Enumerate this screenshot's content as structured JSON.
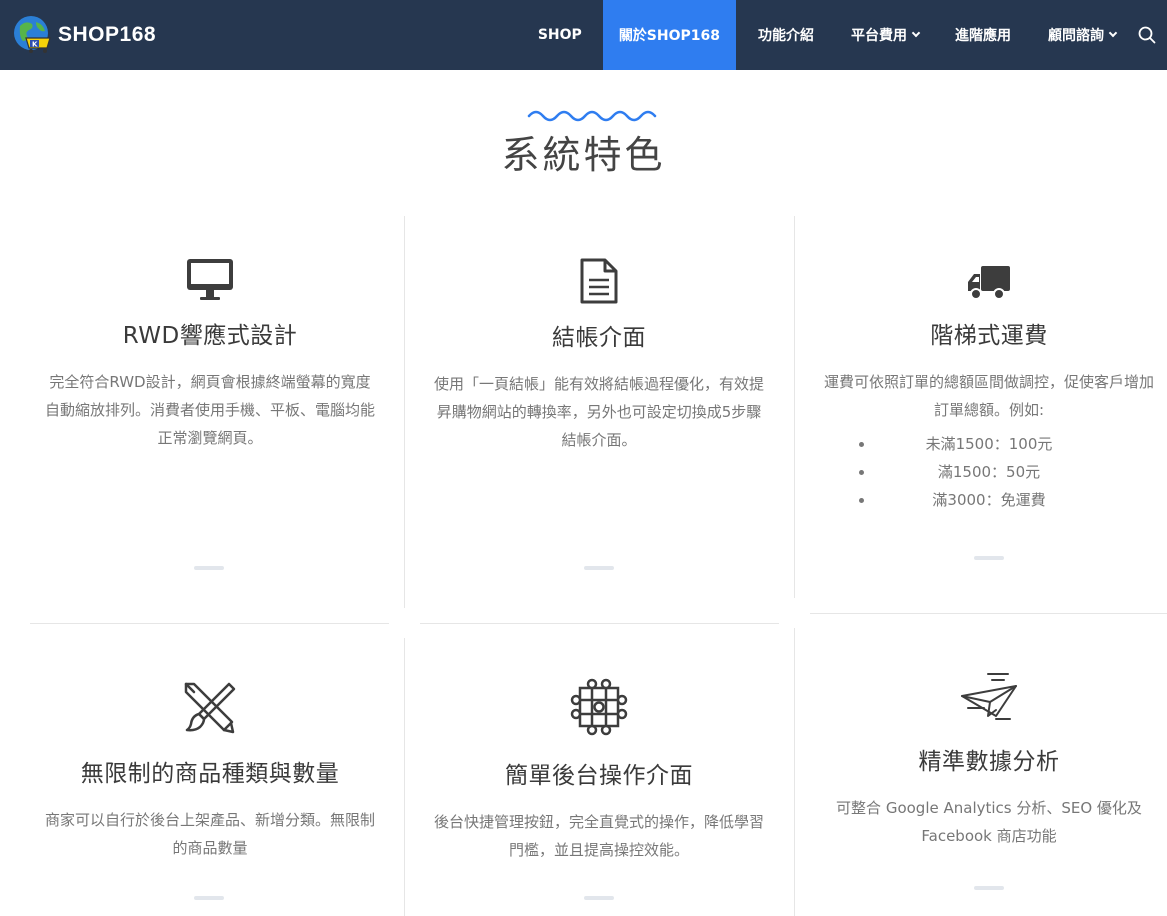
{
  "header": {
    "brand": "SHOP168",
    "nav": [
      {
        "label": "SHOP",
        "active": false,
        "caret": false
      },
      {
        "label": "關於SHOP168",
        "active": true,
        "caret": false
      },
      {
        "label": "功能介紹",
        "active": false,
        "caret": false
      },
      {
        "label": "平台費用",
        "active": false,
        "caret": true
      },
      {
        "label": "進階應用",
        "active": false,
        "caret": false
      },
      {
        "label": "顧問諮詢",
        "active": false,
        "caret": true
      }
    ],
    "search_icon": "search-icon"
  },
  "section": {
    "title": "系統特色"
  },
  "features": [
    {
      "icon": "monitor-icon",
      "title": "RWD響應式設計",
      "desc": "完全符合RWD設計，網頁會根據終端螢幕的寬度自動縮放排列。消費者使用手機、平板、電腦均能正常瀏覽網頁。"
    },
    {
      "icon": "document-icon",
      "title": "結帳介面",
      "desc": "使用「一頁結帳」能有效將結帳過程優化，有效提昇購物網站的轉換率，另外也可設定切換成5步驟結帳介面。"
    },
    {
      "icon": "truck-icon",
      "title": "階梯式運費",
      "desc": "運費可依照訂單的總額區間做調控，促使客戶增加訂單總額。例如:",
      "list": [
        "未滿1500：100元",
        "滿1500：50元",
        "滿3000：免運費"
      ]
    },
    {
      "icon": "pencil-brush-icon",
      "title": "無限制的商品種類與數量",
      "desc": "商家可以自行於後台上架產品、新增分類。無限制的商品數量"
    },
    {
      "icon": "node-grid-icon",
      "title": "簡單後台操作介面",
      "desc": "後台快捷管理按鈕，完全直覺式的操作，降低學習門檻，並且提高操控效能。"
    },
    {
      "icon": "paper-plane-icon",
      "title": "精準數據分析",
      "desc": "可整合 Google Analytics 分析、SEO 優化及 Facebook 商店功能"
    }
  ],
  "colors": {
    "navbar": "#263750",
    "active_nav": "#2f7df0",
    "wave": "#2f7df0"
  }
}
